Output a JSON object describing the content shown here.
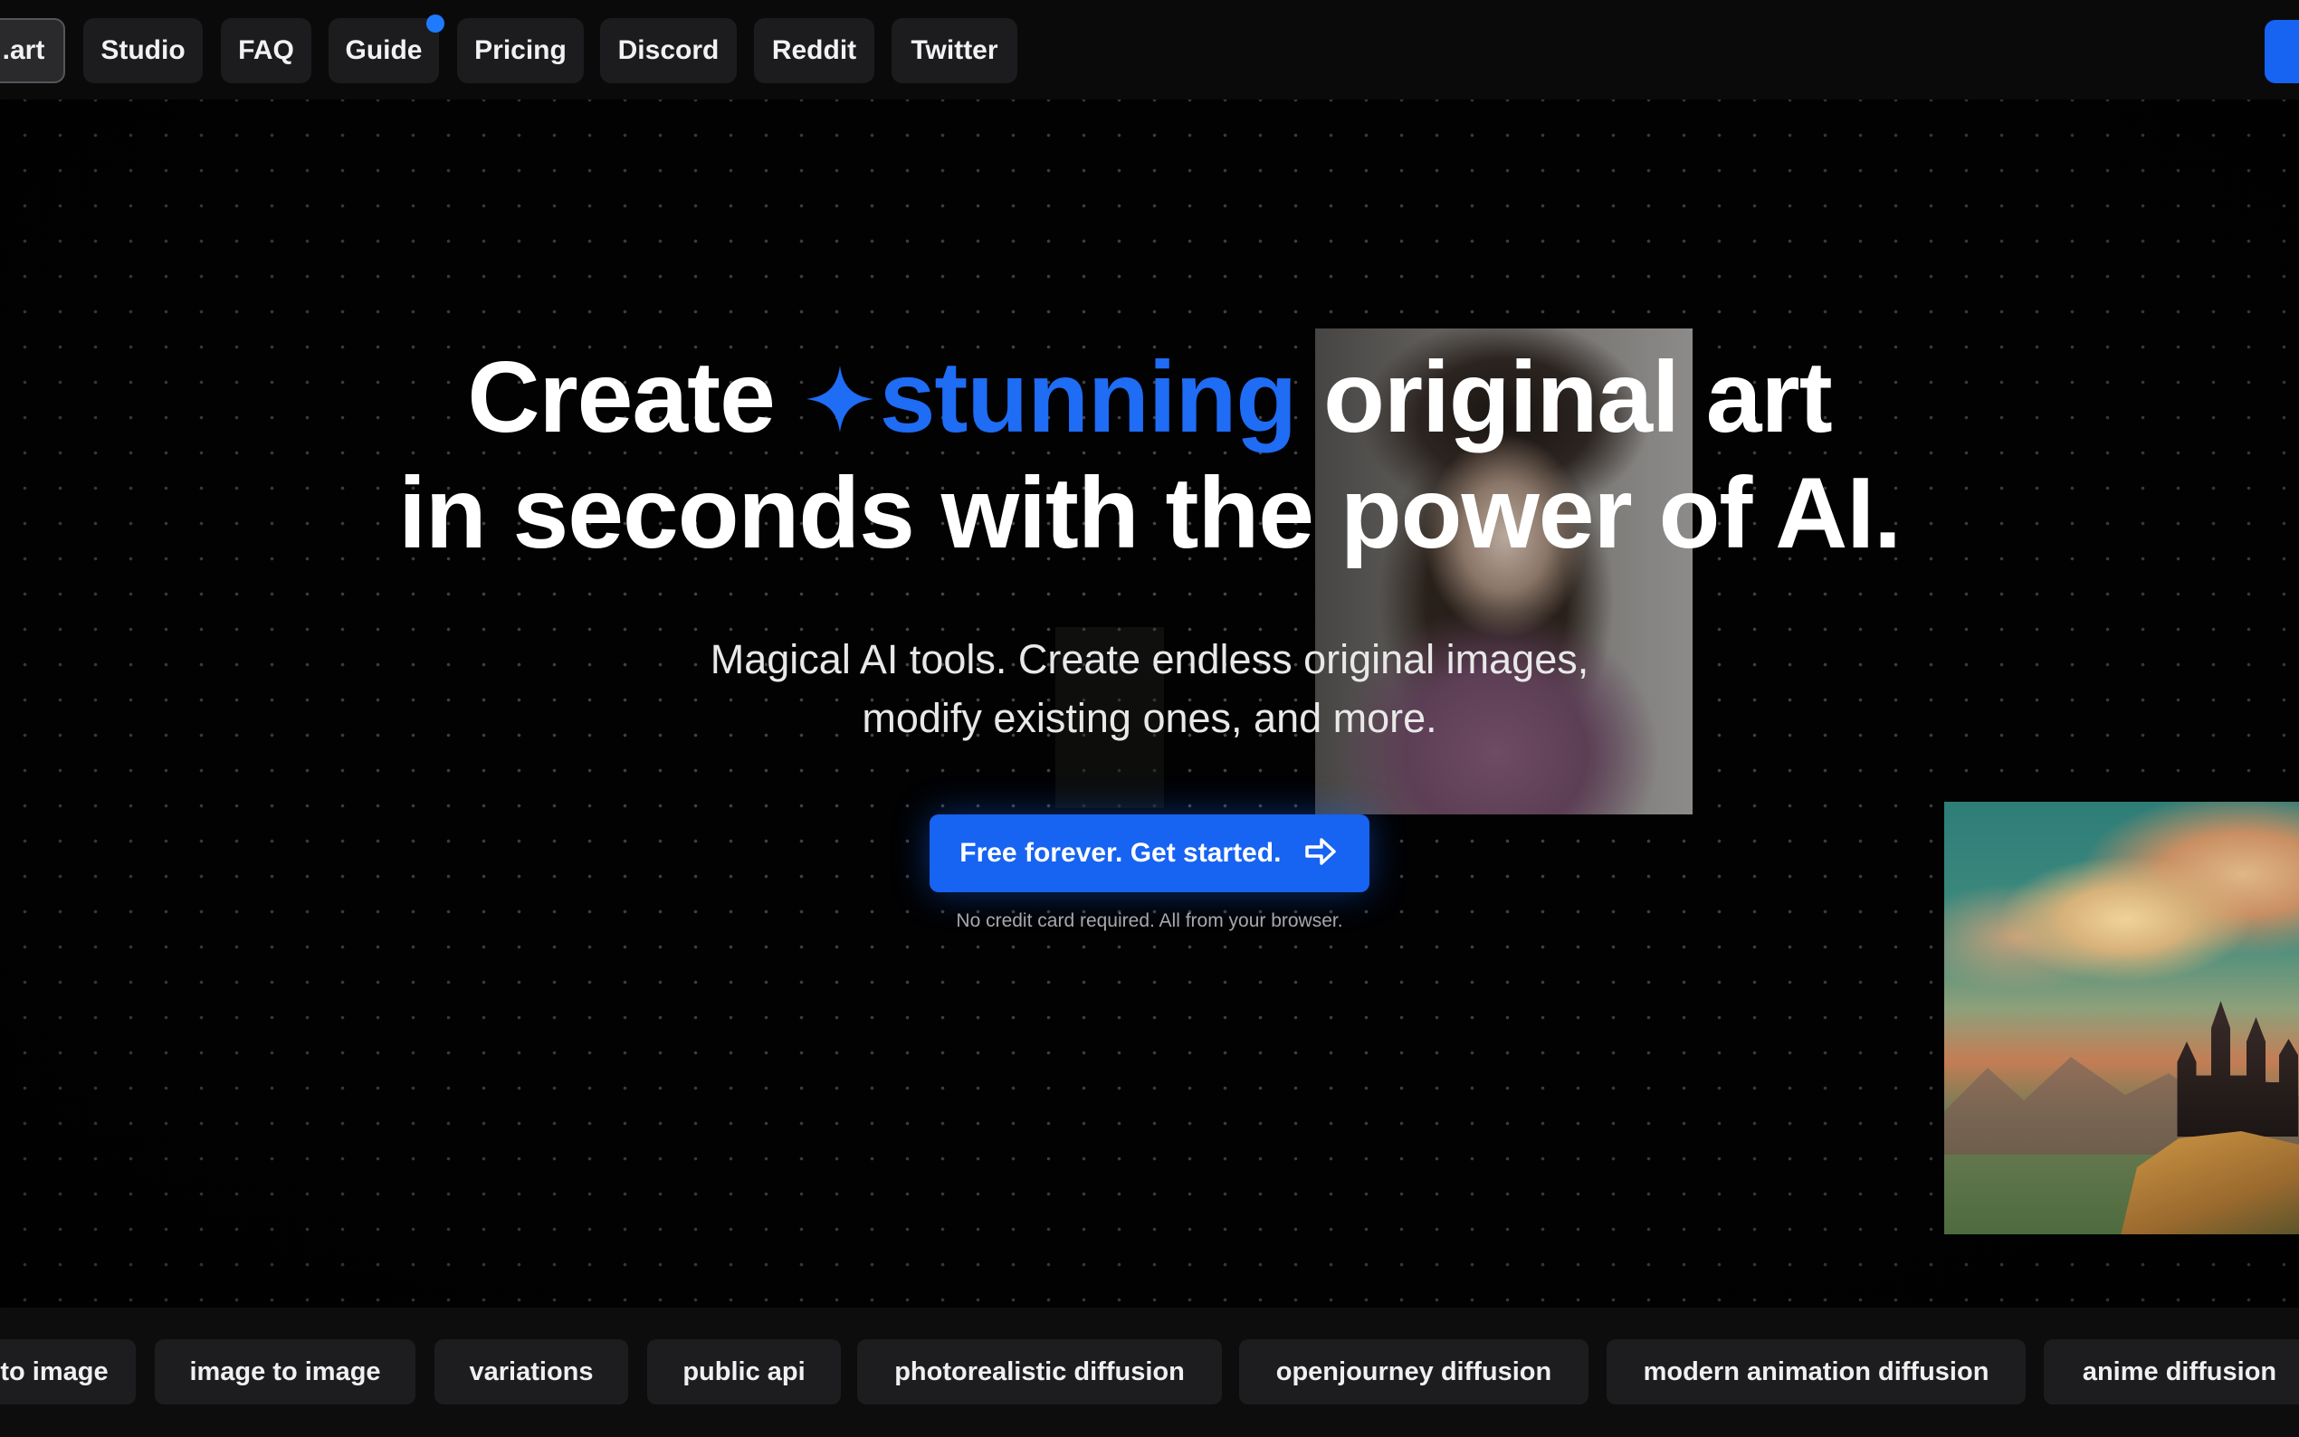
{
  "nav": {
    "items": [
      {
        "label": ".art",
        "active": true
      },
      {
        "label": "Studio",
        "active": false
      },
      {
        "label": "FAQ",
        "active": false
      },
      {
        "label": "Guide",
        "active": false,
        "has_badge": true
      },
      {
        "label": "Pricing",
        "active": false
      },
      {
        "label": "Discord",
        "active": false
      },
      {
        "label": "Reddit",
        "active": false
      },
      {
        "label": "Twitter",
        "active": false
      }
    ]
  },
  "hero": {
    "headline_line1_before": "Create",
    "headline_accent": "stunning",
    "headline_line1_after": "original art",
    "headline_line2": "in seconds with the power of AI.",
    "subtitle_line1": "Magical AI tools. Create endless original images,",
    "subtitle_line2": "modify existing ones, and more.",
    "cta_label": "Free forever. Get started.",
    "note": "No credit card required. All from your browser."
  },
  "tags": [
    "to image",
    "image to image",
    "variations",
    "public api",
    "photorealistic diffusion",
    "openjourney diffusion",
    "modern animation diffusion",
    "anime diffusion"
  ],
  "icons": {
    "sparkle": "sparkle-icon",
    "arrow": "arrow-right-icon"
  },
  "colors": {
    "accent": "#1f6cf5",
    "button": "#1763f2",
    "background": "#020203",
    "badge": "#1e7bff"
  }
}
